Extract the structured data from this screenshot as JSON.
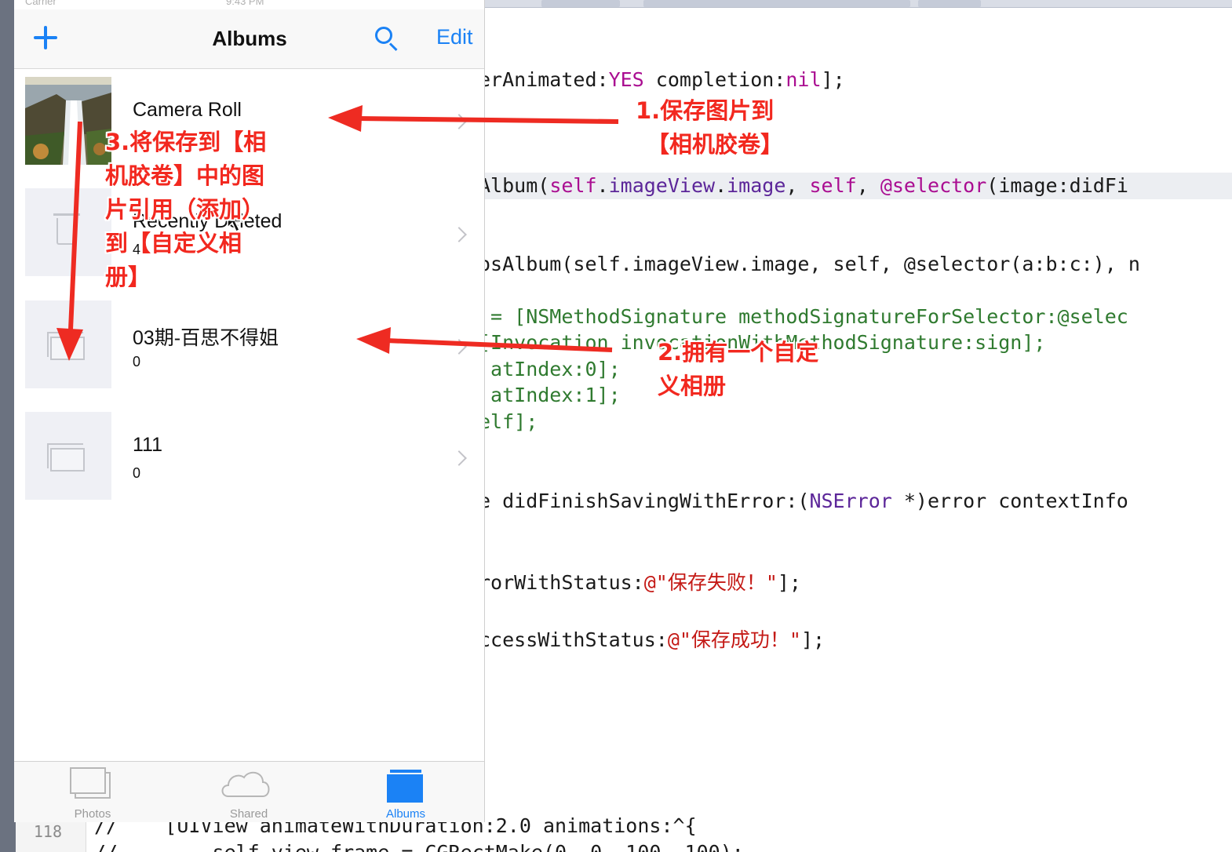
{
  "status_bar": {
    "carrier": "Carrier",
    "time": "9:43 PM"
  },
  "navbar": {
    "title": "Albums",
    "edit_label": "Edit"
  },
  "albums": [
    {
      "name": "Camera Roll",
      "count": ""
    },
    {
      "name": "Recently Deleted",
      "count": "4"
    },
    {
      "name": "03期-百思不得姐",
      "count": "0"
    },
    {
      "name": "111",
      "count": "0"
    }
  ],
  "tabbar": {
    "tabs": [
      {
        "label": "Photos",
        "active": false
      },
      {
        "label": "Shared",
        "active": false
      },
      {
        "label": "Albums",
        "active": true
      }
    ]
  },
  "annotations": {
    "a1_line1": "1.保存图片到",
    "a1_line2": "【相机胶卷】",
    "a2_line1": "2.拥有一个自定",
    "a2_line2": "义相册",
    "a3_line1": "3.将保存到【相",
    "a3_line2": "机胶卷】中的图",
    "a3_line3": "片引用（添加）",
    "a3_line4": "到【自定义相",
    "a3_line5": "册】"
  },
  "code": {
    "l1": "erAnimated:YES completion:nil];",
    "l2": "Album(self.imageView.image, self, @selector(image:didFi",
    "l3": "osAlbum(self.imageView.image, self, @selector(a:b:c:), n",
    "l4": " = [NSMethodSignature methodSignatureForSelector:@selec",
    "l5": "[Invocation invocationWithMethodSignature:sign];",
    "l6": " atIndex:0];",
    "l7": " atIndex:1];",
    "l8": "elf];",
    "l9": "e didFinishSavingWithError:(NSError *)error contextInfo",
    "l10": "rorWithStatus:@\"保存失败！\"];",
    "l11": "ccessWithStatus:@\"保存成功！\"];",
    "line_number": "118",
    "bottom1": "//    [UIView animateWithDuration:2.0 animations:^{",
    "bottom2": "//        self.view.frame = CGRectMake(0, 0, 100, 100);"
  },
  "colors": {
    "accent": "#1b82f5",
    "annotation": "#f2281f"
  },
  "icons": [
    "plus-icon",
    "search-icon",
    "chevron-right-icon",
    "trash-icon",
    "folder-icon",
    "photos-tab-icon",
    "cloud-icon",
    "albums-tab-icon",
    "mouse-cursor-icon"
  ]
}
